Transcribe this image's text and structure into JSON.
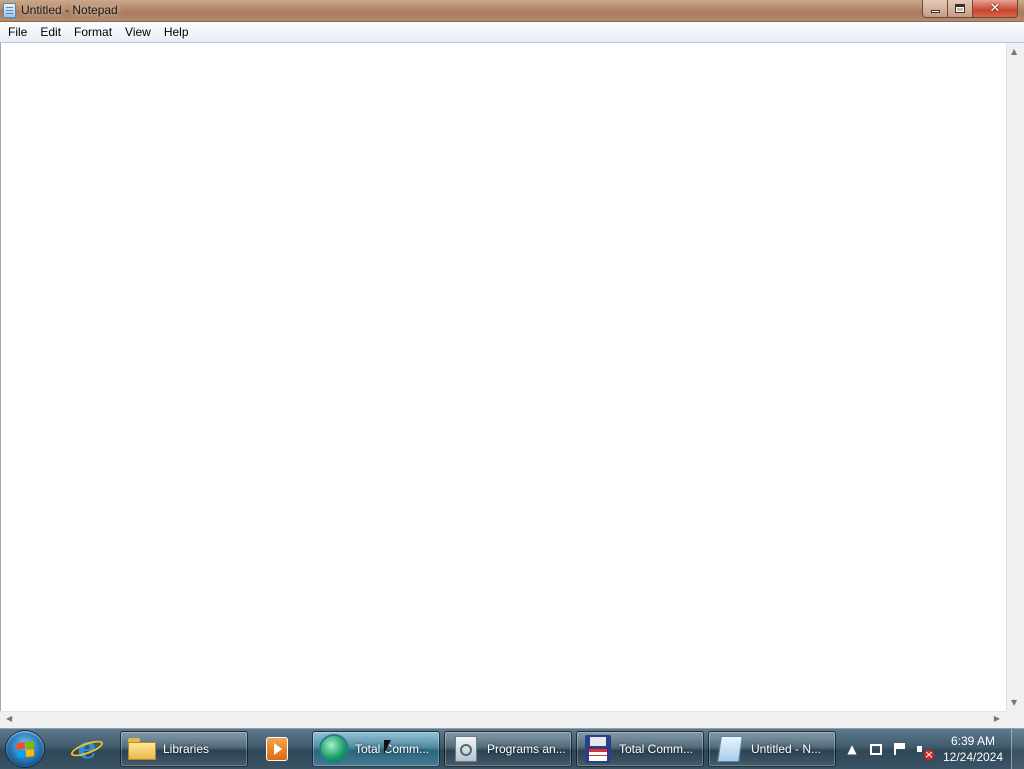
{
  "window": {
    "title": "Untitled - Notepad",
    "icon": "notepad-icon"
  },
  "menu": {
    "items": [
      "File",
      "Edit",
      "Format",
      "View",
      "Help"
    ]
  },
  "editor": {
    "content": ""
  },
  "taskbar": {
    "start_icon": "windows-logo-icon",
    "pinned": [
      {
        "name": "internet-explorer-icon"
      },
      {
        "name": "media-player-icon"
      }
    ],
    "buttons": [
      {
        "label": "Libraries",
        "icon": "folder-icon",
        "active": false
      },
      {
        "label": "Total Comm...",
        "icon": "globe-icon",
        "active": true
      },
      {
        "label": "Programs an...",
        "icon": "programs-icon",
        "active": false
      },
      {
        "label": "Total Comm...",
        "icon": "floppy-disk-icon",
        "active": false
      },
      {
        "label": "Untitled - N...",
        "icon": "notepad-icon",
        "active": false
      }
    ],
    "tray": {
      "icons": [
        "show-hidden-icons-icon",
        "network-icon",
        "action-center-flag-icon",
        "volume-muted-icon"
      ],
      "time": "6:39 AM",
      "date": "12/24/2024"
    }
  },
  "colors": {
    "titlebar": "#b7886a",
    "taskbar": "#3f5a6c",
    "close_button": "#c7472d"
  }
}
